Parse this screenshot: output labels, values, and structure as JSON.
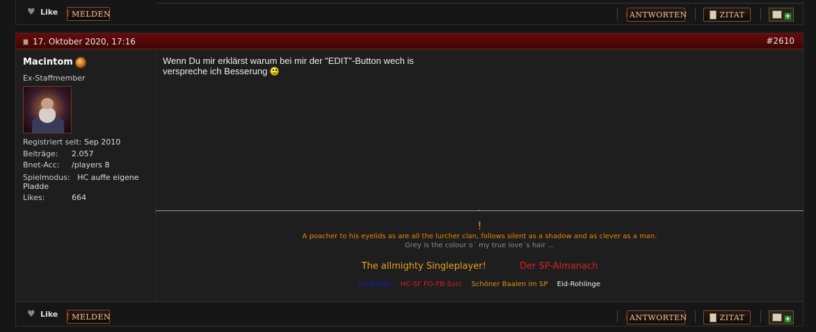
{
  "actions": {
    "like_label": "Like",
    "report_label": "MELDEN",
    "reply_label": "ANTWORTEN",
    "quote_label": "ZITAT"
  },
  "post": {
    "date": "17. Oktober 2020, 17:16",
    "number": "#2610",
    "author": {
      "name": "Macintom",
      "title": "Ex-Staffmember",
      "stats": [
        {
          "label": "Registriert seit:",
          "value": "Sep 2010"
        },
        {
          "label": "Beiträge:",
          "value": "2.057"
        },
        {
          "label": "Bnet-Acc:",
          "value": "/players 8"
        },
        {
          "label": "Spielmodus:",
          "value": "HC auffe eigene Pladde"
        },
        {
          "label": "Likes:",
          "value": "664"
        }
      ]
    },
    "message_line1": "Wenn Du mir erklärst warum bei mir der \"EDIT\"-Button wech is",
    "message_line2": "verspreche ich Besserung",
    "signature": {
      "exclaim": "!",
      "quote1": "A poacher to his eyelids as are all the lurcher clan, follows silent as a shadow and as clever as a man.",
      "quote2": "Grey is the colour o´ my true love´s hair ...",
      "link_a": "The allmighty Singleplayer!",
      "link_b": "Der SP-Almanach",
      "link_c": "Lo-Rovan",
      "link_d": "HC-SF FO-FB-Sorc",
      "link_e": "Schöner Baalen im SP",
      "link_f": "Eid-Rohlinge"
    }
  },
  "colors": {
    "header_red": "#6a0a0a",
    "background": "#161616",
    "signature_orange": "#e8860a"
  }
}
